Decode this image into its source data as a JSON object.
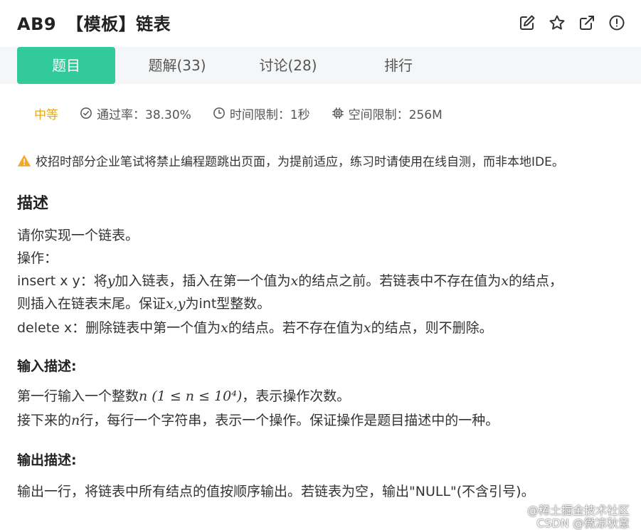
{
  "header": {
    "problem_code": "AB9",
    "problem_title": "【模板】链表"
  },
  "tabs": [
    {
      "label": "题目"
    },
    {
      "label": "题解(33)"
    },
    {
      "label": "讨论(28)"
    },
    {
      "label": "排行"
    }
  ],
  "meta": {
    "difficulty": "中等",
    "pass_rate": "通过率：38.30%",
    "time_limit": "时间限制：1秒",
    "space_limit": "空间限制：256M"
  },
  "colors": {
    "accent": "#32ca99",
    "difficulty": "#e6a817",
    "warning": "#f5a623"
  },
  "notice": "校招时部分企业笔试将禁止编程题跳出页面，为提前适应，练习时请使用在线自测，而非本地IDE。",
  "description": {
    "heading": "描述",
    "line1": "请你实现一个链表。",
    "line2": "操作：",
    "line3_a": "insert x y：将",
    "line3_var1": "y",
    "line3_b": "加入链表，插入在第一个值为",
    "line3_var2": "x",
    "line3_c": "的结点之前。若链表中不存在值为",
    "line3_var3": "x",
    "line3_d": "的结点，",
    "line4_a": "则插入在链表末尾。保证",
    "line4_var": "x,y",
    "line4_b": "为int型整数。",
    "line5_a": "delete x：删除链表中第一个值为",
    "line5_var1": "x",
    "line5_b": "的结点。若不存在值为",
    "line5_var2": "x",
    "line5_c": "的结点，则不删除。"
  },
  "input": {
    "heading": "输入描述:",
    "line1_a": "第一行输入一个整数",
    "line1_math": "n (1 ≤ n ≤ 10⁴)",
    "line1_b": "，表示操作次数。",
    "line2_a": "接下来的",
    "line2_var": "n",
    "line2_b": "行，每行一个字符串，表示一个操作。保证操作是题目描述中的一种。"
  },
  "output": {
    "heading": "输出描述:",
    "line1": "输出一行，将链表中所有结点的值按顺序输出。若链表为空，输出\"NULL\"(不含引号)。"
  },
  "watermark": {
    "line1": "@稀土掘金技术社区",
    "line2": "CSDN @微凉秋意"
  }
}
